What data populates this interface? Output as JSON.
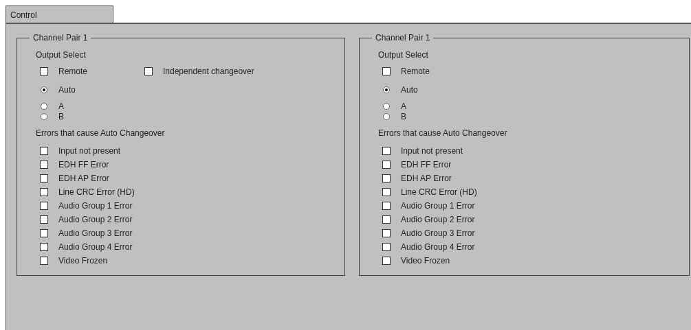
{
  "tabs": [
    {
      "label": "Control",
      "selected": true
    }
  ],
  "panels": [
    {
      "title": "Channel Pair 1",
      "output_select_label": "Output Select",
      "toggles": [
        {
          "label": "Remote",
          "checked": false
        },
        {
          "label": "Independent changeover",
          "checked": false
        }
      ],
      "outputs": [
        {
          "label": "Auto",
          "selected": true
        },
        {
          "label": "A",
          "selected": false
        },
        {
          "label": "B",
          "selected": false
        }
      ],
      "errors_label": "Errors that cause Auto Changeover",
      "errors": [
        {
          "label": "Input not present",
          "checked": false
        },
        {
          "label": "EDH FF Error",
          "checked": false
        },
        {
          "label": "EDH AP Error",
          "checked": false
        },
        {
          "label": "Line CRC Error (HD)",
          "checked": false
        },
        {
          "label": "Audio Group 1 Error",
          "checked": false
        },
        {
          "label": "Audio Group 2 Error",
          "checked": false
        },
        {
          "label": "Audio Group 3 Error",
          "checked": false
        },
        {
          "label": "Audio Group 4 Error",
          "checked": false
        },
        {
          "label": "Video Frozen",
          "checked": false
        }
      ]
    },
    {
      "title": "Channel Pair 1",
      "output_select_label": "Output Select",
      "toggles": [
        {
          "label": "Remote",
          "checked": false
        }
      ],
      "outputs": [
        {
          "label": "Auto",
          "selected": true
        },
        {
          "label": "A",
          "selected": false
        },
        {
          "label": "B",
          "selected": false
        }
      ],
      "errors_label": "Errors that cause Auto Changeover",
      "errors": [
        {
          "label": "Input not present",
          "checked": false
        },
        {
          "label": "EDH FF Error",
          "checked": false
        },
        {
          "label": "EDH AP Error",
          "checked": false
        },
        {
          "label": "Line CRC Error (HD)",
          "checked": false
        },
        {
          "label": "Audio Group 1 Error",
          "checked": false
        },
        {
          "label": "Audio Group 2 Error",
          "checked": false
        },
        {
          "label": "Audio Group 3 Error",
          "checked": false
        },
        {
          "label": "Audio Group 4 Error",
          "checked": false
        },
        {
          "label": "Video Frozen",
          "checked": false
        }
      ]
    }
  ]
}
